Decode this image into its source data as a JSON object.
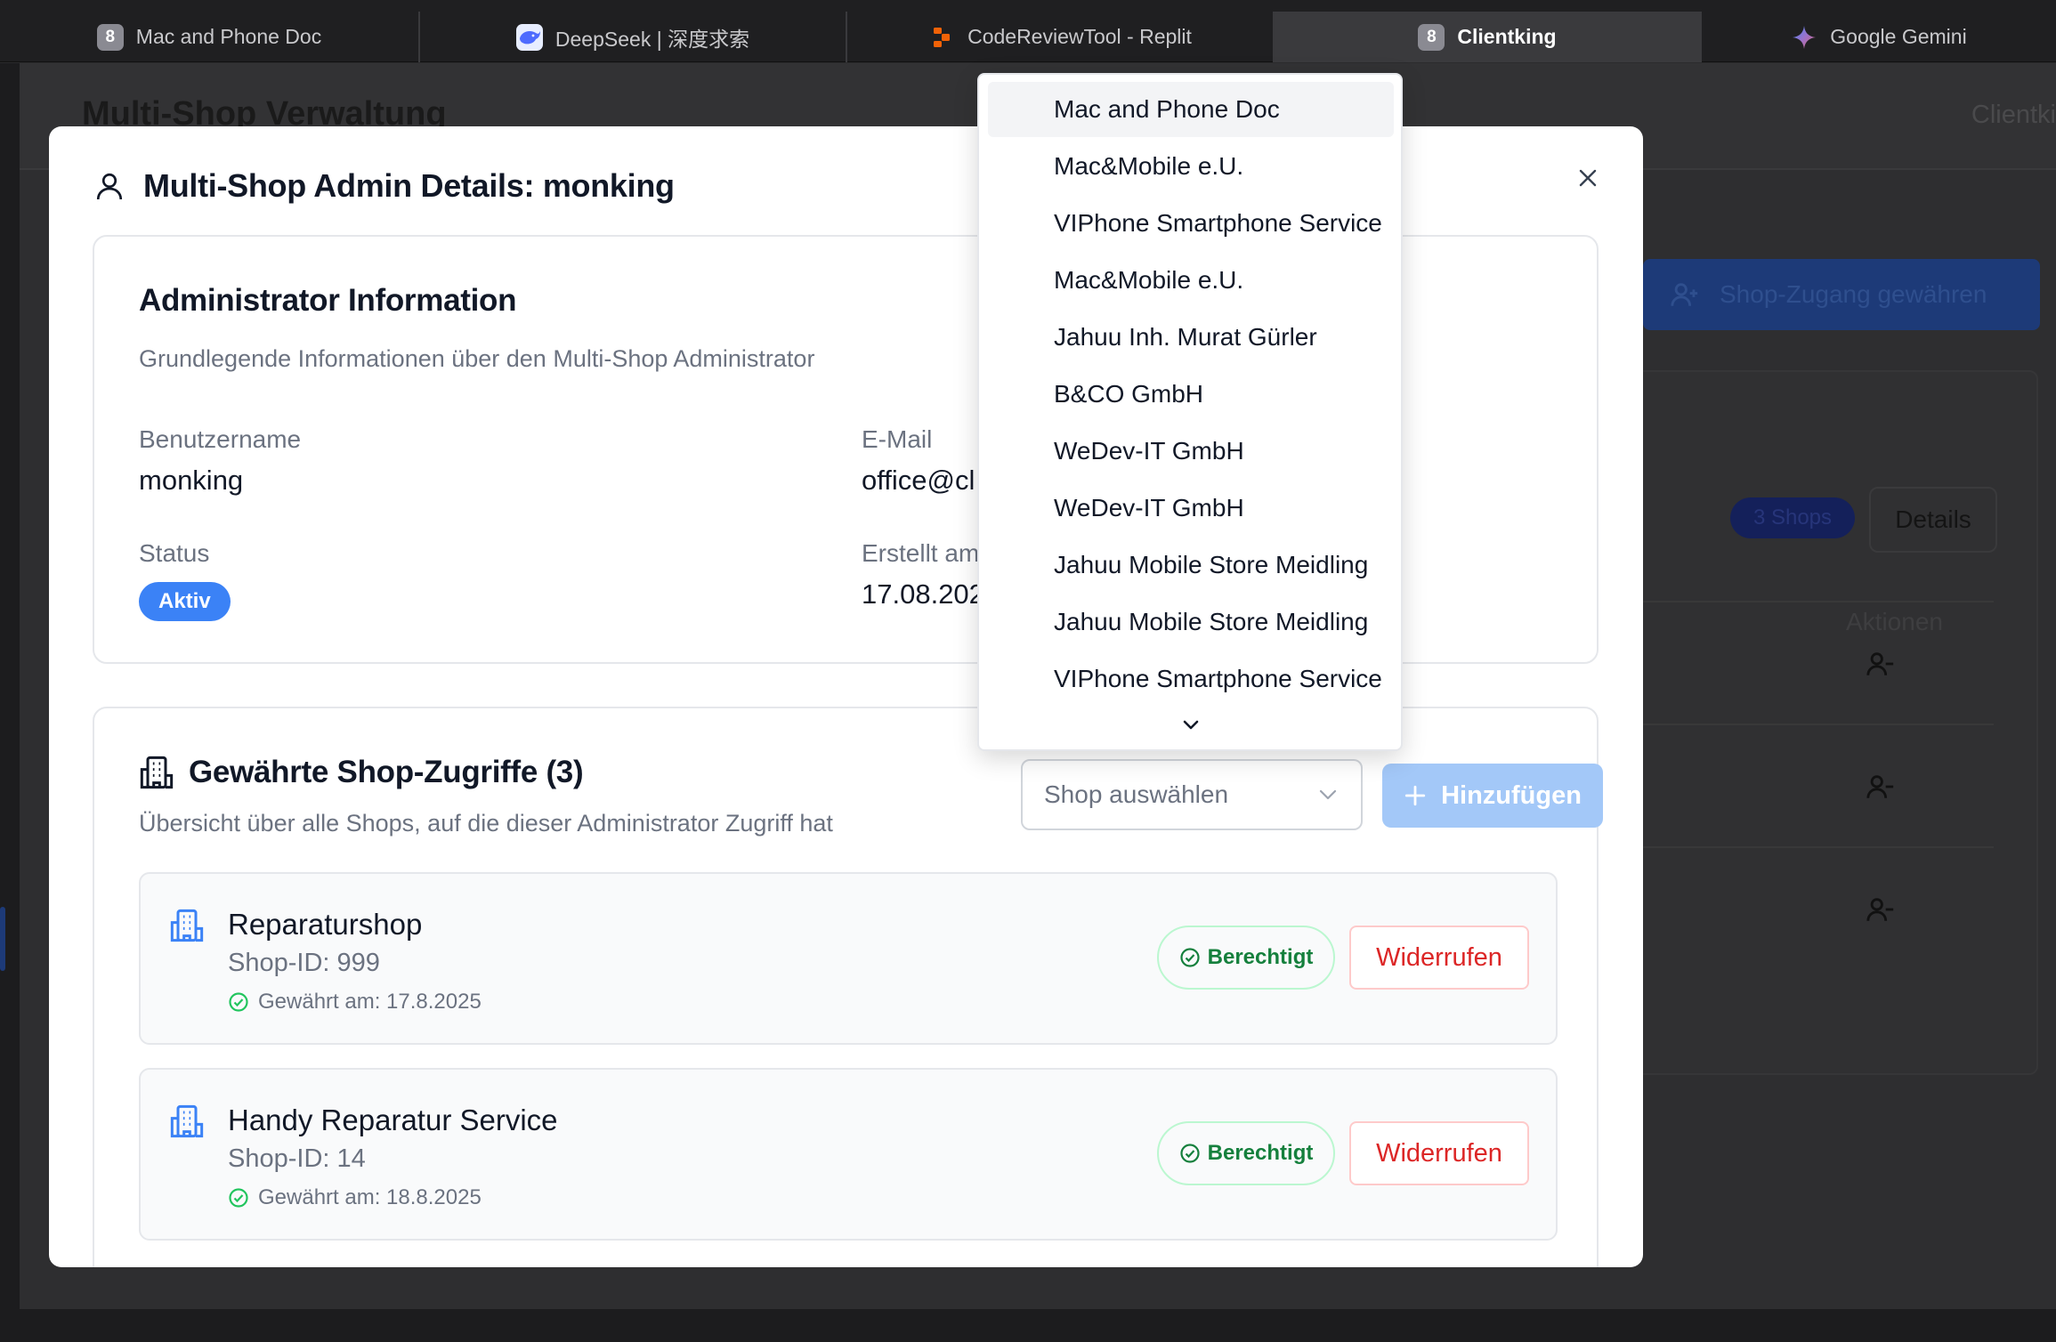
{
  "browser": {
    "tabs": [
      {
        "label": "Mac and Phone Doc",
        "favicon": "eight-badge-icon"
      },
      {
        "label": "DeepSeek | 深度求索",
        "favicon": "deepseek-whale-icon"
      },
      {
        "label": "CodeReviewTool - Replit",
        "favicon": "replit-icon"
      },
      {
        "label": "Clientking",
        "favicon": "eight-badge-icon",
        "active": true
      },
      {
        "label": "Google Gemini",
        "favicon": "gemini-sparkle-icon"
      }
    ],
    "favicon_text": "8"
  },
  "background_app": {
    "title": "Multi-Shop Verwaltung",
    "brand": "Clientki",
    "grant_button": "Shop-Zugang gewähren",
    "shops_badge": "3 Shops",
    "details_button": "Details",
    "actions_header": "Aktionen"
  },
  "modal": {
    "title": "Multi-Shop Admin Details: monking",
    "admin_card": {
      "title": "Administrator Information",
      "subtitle": "Grundlegende Informationen über den Multi-Shop Administrator",
      "username_label": "Benutzername",
      "username_value": "monking",
      "email_label": "E-Mail",
      "email_value": "office@cl",
      "status_label": "Status",
      "status_value": "Aktiv",
      "created_label": "Erstellt am",
      "created_value": "17.08.202"
    },
    "access_card": {
      "title": "Gewährte Shop-Zugriffe (3)",
      "subtitle": "Übersicht über alle Shops, auf die dieser Administrator Zugriff hat",
      "select_placeholder": "Shop auswählen",
      "add_button": "Hinzufügen",
      "shops": [
        {
          "name": "Reparaturshop",
          "shop_id": "Shop-ID: 999",
          "granted": "Gewährt am: 17.8.2025",
          "status": "Berechtigt",
          "revoke": "Widerrufen"
        },
        {
          "name": "Handy Reparatur Service",
          "shop_id": "Shop-ID: 14",
          "granted": "Gewährt am: 18.8.2025",
          "status": "Berechtigt",
          "revoke": "Widerrufen"
        }
      ]
    }
  },
  "dropdown": {
    "options": [
      "Mac and Phone Doc",
      "Mac&Mobile e.U.",
      "VIPhone Smartphone Service",
      "Mac&Mobile e.U.",
      "Jahuu Inh. Murat Gürler",
      "B&CO GmbH",
      "WeDev-IT GmbH",
      "WeDev-IT GmbH",
      "Jahuu Mobile Store Meidling",
      "Jahuu Mobile Store Meidling",
      "VIPhone Smartphone Service"
    ],
    "highlighted_index": 0
  },
  "colors": {
    "accent": "#3b82f6",
    "add_button_disabled": "#a3c8f8",
    "success": "#15803d",
    "danger": "#dc2626"
  }
}
